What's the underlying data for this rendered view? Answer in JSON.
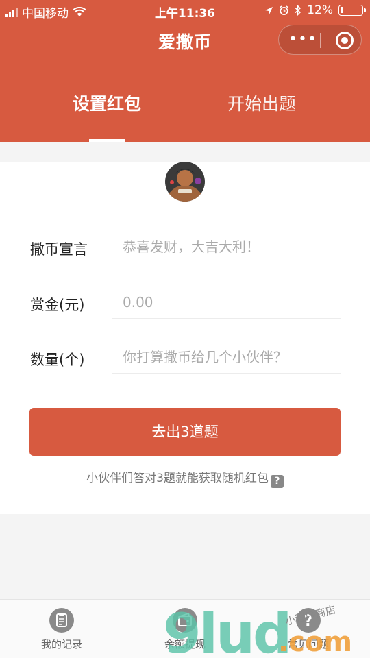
{
  "status_bar": {
    "carrier": "中国移动",
    "time": "上午11:36",
    "battery": "12%"
  },
  "nav": {
    "title": "爱撒币",
    "more_glyph": "•••"
  },
  "tabs": [
    {
      "label": "设置红包",
      "active": true
    },
    {
      "label": "开始出题",
      "active": false
    }
  ],
  "form": {
    "rows": [
      {
        "label": "撒币宣言",
        "placeholder": "恭喜发财，大吉大利！"
      },
      {
        "label": "赏金(元)",
        "placeholder": "0.00"
      },
      {
        "label": "数量(个)",
        "placeholder": "你打算撒币给几个小伙伴？"
      }
    ],
    "submit_label": "去出3道题",
    "tip": "小伙伴们答对3题就能获取随机红包",
    "tip_icon": "?"
  },
  "tabbar": [
    {
      "label": "我的记录",
      "icon": "clipboard-icon"
    },
    {
      "label": "余额提现",
      "icon": "wallet-icon"
    },
    {
      "label": "常见问题",
      "icon": "help-icon"
    }
  ],
  "watermark": {
    "big": "9lud",
    "suffix": ".com",
    "script": "小程序商店"
  },
  "colors": {
    "accent": "#d75a40",
    "background": "#f4f4f4",
    "watermark_green": "#5cc3a8",
    "watermark_orange": "#f0a03c"
  }
}
